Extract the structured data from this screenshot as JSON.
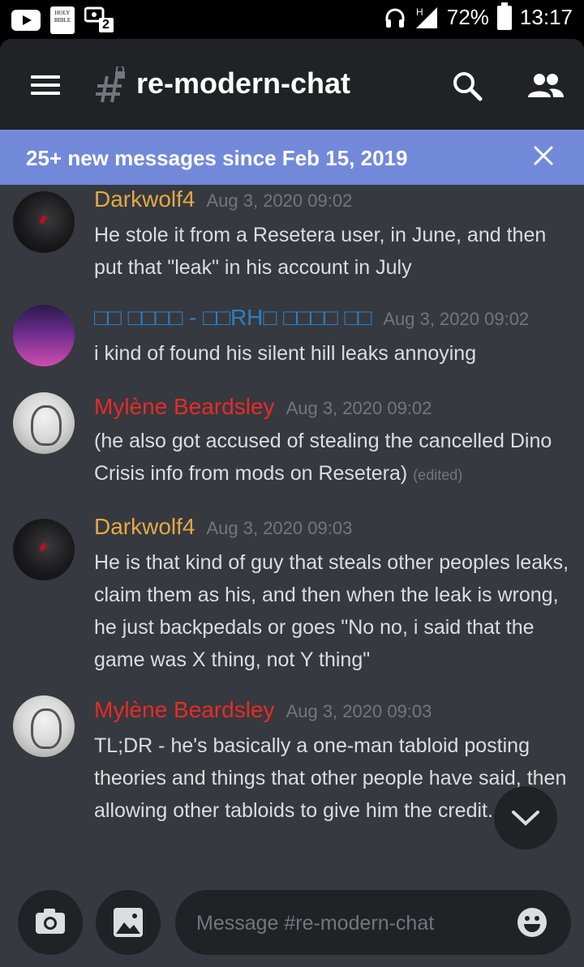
{
  "status_bar": {
    "battery": "72%",
    "time": "13:17",
    "network": "H",
    "bible_icon_text": "HOLY BIBLE",
    "notification_badge": "2"
  },
  "header": {
    "channel": "re-modern-chat"
  },
  "banner": {
    "text": "25+ new messages since Feb 15, 2019"
  },
  "messages": [
    {
      "author": "Darkwolf4",
      "author_color": "#e5a845",
      "timestamp": "Aug 3, 2020 09:02",
      "text": "He stole it from a Resetera user, in June, and then put that \"leak\" in his account in July",
      "edited": ""
    },
    {
      "author": "□□ □□□□ - □□RH□ □□□□ □□",
      "author_color": "#2e7fc4",
      "timestamp": "Aug 3, 2020 09:02",
      "text": "i kind of found his silent hill leaks annoying",
      "edited": ""
    },
    {
      "author": "Mylène Beardsley",
      "author_color": "#e82b26",
      "timestamp": "Aug 3, 2020 09:02",
      "text": "(he also got accused of stealing the cancelled Dino Crisis info from mods on Resetera)",
      "edited": "(edited)"
    },
    {
      "author": "Darkwolf4",
      "author_color": "#e5a845",
      "timestamp": "Aug 3, 2020 09:03",
      "text": "He is that kind of guy that steals other peoples leaks, claim them as his, and then when the leak is wrong, he just backpedals or goes \"No no, i said that the game was X thing, not Y thing\"",
      "edited": ""
    },
    {
      "author": "Mylène Beardsley",
      "author_color": "#e82b26",
      "timestamp": "Aug 3, 2020 09:03",
      "text": "TL;DR - he's basically a one-man tabloid posting theories and things that other people have said, then allowing other tabloids to give him the credit.",
      "edited": ""
    }
  ],
  "composer": {
    "placeholder": "Message #re-modern-chat"
  },
  "colors": {
    "background": "#36393f",
    "header": "#202225",
    "banner": "#7289da",
    "text": "#dcddde",
    "muted": "#72767d"
  },
  "icons": [
    "youtube-icon",
    "bible-app-icon",
    "game-app-icon",
    "headset-icon",
    "signal-icon",
    "battery-icon",
    "menu-icon",
    "locked-hash-icon",
    "search-icon",
    "members-icon",
    "close-icon",
    "chevron-down-icon",
    "camera-icon",
    "image-icon",
    "emoji-icon"
  ]
}
